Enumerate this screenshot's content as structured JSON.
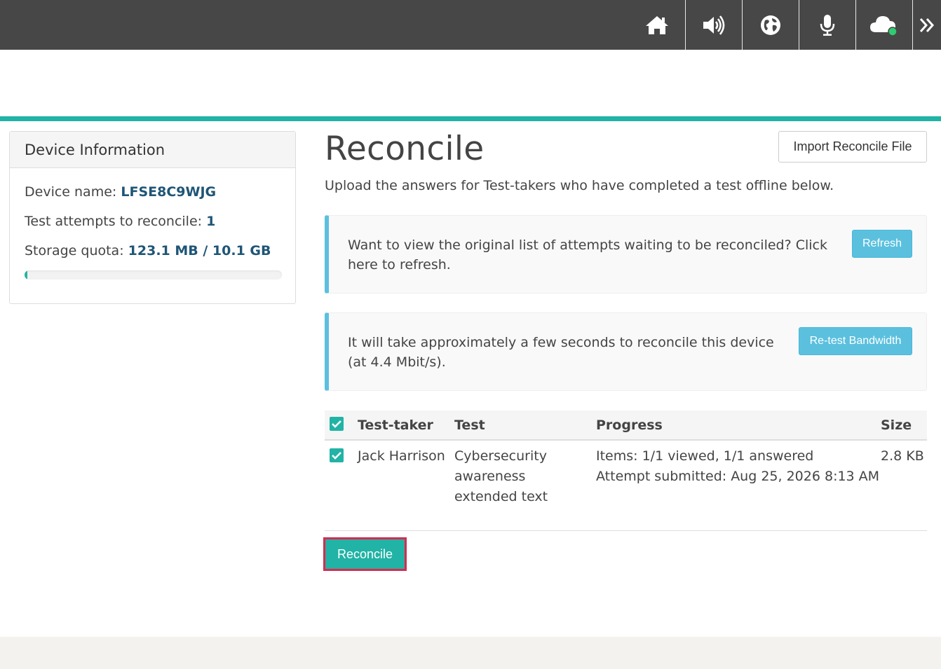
{
  "topbar": {
    "icons": [
      "home-icon",
      "speaker-icon",
      "globe-icon",
      "microphone-icon",
      "cloud-icon",
      "double-chevron-right-icon"
    ],
    "connection_status_color": "#2ecc71"
  },
  "colors": {
    "accent": "#21b3a5",
    "info": "#5bc0de",
    "highlight_border": "#d9294f",
    "link": "#1f5576"
  },
  "device": {
    "heading": "Device Information",
    "name_label": "Device name:",
    "name_value": "LFSE8C9WJG",
    "attempts_label": "Test attempts to reconcile:",
    "attempts_value": "1",
    "storage_label": "Storage quota:",
    "storage_value": "123.1 MB / 10.1 GB",
    "storage_fraction": 0.012
  },
  "main": {
    "title": "Reconcile",
    "import_button": "Import Reconcile File",
    "subtitle": "Upload the answers for Test-takers who have completed a test offline below.",
    "callout_refresh": {
      "line1": "Want to view the original list of attempts waiting to be reconciled? Click",
      "line2": "here to refresh.",
      "button": "Refresh"
    },
    "callout_bandwidth": {
      "line1": "It will take approximately a few seconds to reconcile this device",
      "line2": "(at 4.4 Mbit/s).",
      "button": "Re-test Bandwidth"
    }
  },
  "table": {
    "headers": [
      "Test-taker",
      "Test",
      "Progress",
      "Size"
    ],
    "rows": [
      {
        "checked": true,
        "test_taker": "Jack Harrison",
        "test_lines": [
          "Cybersecurity",
          "awareness",
          "extended text"
        ],
        "progress_lines": [
          "Items: 1/1 viewed, 1/1 answered",
          "Attempt submitted: Aug 25, 2026 8:13 AM"
        ],
        "size": "2.8 KB"
      }
    ]
  },
  "reconcile_button": "Reconcile"
}
